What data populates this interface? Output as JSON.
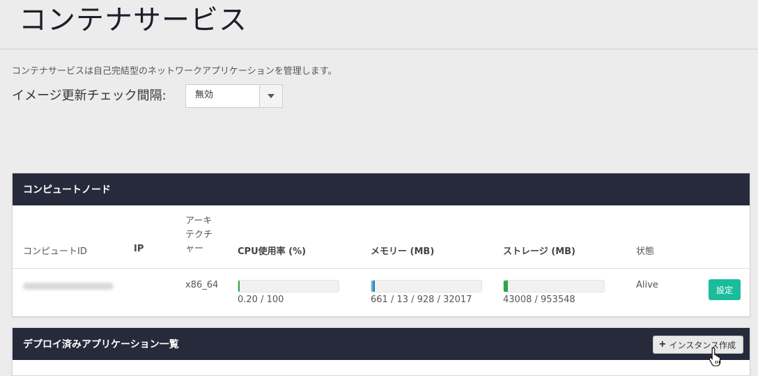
{
  "page": {
    "title": "コンテナサービス",
    "description": "コンテナサービスは自己完結型のネットワークアプリケーションを管理します。"
  },
  "image_check": {
    "label": "イメージ更新チェック間隔:",
    "selected": "無効"
  },
  "compute_nodes": {
    "title": "コンピュートノード",
    "columns": {
      "id": "コンピュートID",
      "ip": "IP",
      "arch": "アーキテクチャー",
      "cpu": "CPU使用率 (%)",
      "memory": "メモリー (MB)",
      "storage": "ストレージ (MB)",
      "status": "状態"
    },
    "rows": [
      {
        "ip": "",
        "arch": "x86_64",
        "cpu_text": "0.20 / 100",
        "cpu_fraction": 0.002,
        "memory_text": "661 / 13 / 928 / 32017",
        "memory_fraction": 0.021,
        "memory_sub_fraction": 0.029,
        "storage_text": "43008 / 953548",
        "storage_fraction": 0.045,
        "status": "Alive",
        "settings_label": "設定"
      }
    ]
  },
  "deployed_apps": {
    "title": "デプロイ済みアプリケーション一覧",
    "create_label": "インスタンス作成"
  },
  "colors": {
    "panel_header": "#272a3b",
    "accent": "#1abc9c",
    "cpu_bar": "#2ca64a",
    "memory_bar": "#5bb0e3",
    "memory_sub_bar": "#2a74ad",
    "storage_bar": "#2ca64a"
  }
}
